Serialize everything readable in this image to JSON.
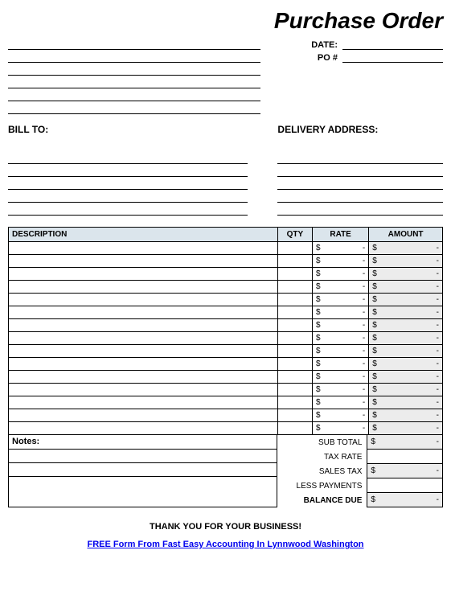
{
  "title": "Purchase Order",
  "meta": {
    "date_label": "DATE:",
    "date_value": "",
    "po_label": "PO #",
    "po_value": ""
  },
  "sections": {
    "bill_to": "BILL TO:",
    "delivery_address": "DELIVERY ADDRESS:"
  },
  "table": {
    "headers": {
      "description": "DESCRIPTION",
      "qty": "QTY",
      "rate": "RATE",
      "amount": "AMOUNT"
    },
    "rows": [
      {
        "desc": "",
        "qty": "",
        "rate_sym": "$",
        "rate_val": "-",
        "amt_sym": "$",
        "amt_val": "-"
      },
      {
        "desc": "",
        "qty": "",
        "rate_sym": "$",
        "rate_val": "-",
        "amt_sym": "$",
        "amt_val": "-"
      },
      {
        "desc": "",
        "qty": "",
        "rate_sym": "$",
        "rate_val": "-",
        "amt_sym": "$",
        "amt_val": "-"
      },
      {
        "desc": "",
        "qty": "",
        "rate_sym": "$",
        "rate_val": "-",
        "amt_sym": "$",
        "amt_val": "-"
      },
      {
        "desc": "",
        "qty": "",
        "rate_sym": "$",
        "rate_val": "-",
        "amt_sym": "$",
        "amt_val": "-"
      },
      {
        "desc": "",
        "qty": "",
        "rate_sym": "$",
        "rate_val": "-",
        "amt_sym": "$",
        "amt_val": "-"
      },
      {
        "desc": "",
        "qty": "",
        "rate_sym": "$",
        "rate_val": "-",
        "amt_sym": "$",
        "amt_val": "-"
      },
      {
        "desc": "",
        "qty": "",
        "rate_sym": "$",
        "rate_val": "-",
        "amt_sym": "$",
        "amt_val": "-"
      },
      {
        "desc": "",
        "qty": "",
        "rate_sym": "$",
        "rate_val": "-",
        "amt_sym": "$",
        "amt_val": "-"
      },
      {
        "desc": "",
        "qty": "",
        "rate_sym": "$",
        "rate_val": "-",
        "amt_sym": "$",
        "amt_val": "-"
      },
      {
        "desc": "",
        "qty": "",
        "rate_sym": "$",
        "rate_val": "-",
        "amt_sym": "$",
        "amt_val": "-"
      },
      {
        "desc": "",
        "qty": "",
        "rate_sym": "$",
        "rate_val": "-",
        "amt_sym": "$",
        "amt_val": "-"
      },
      {
        "desc": "",
        "qty": "",
        "rate_sym": "$",
        "rate_val": "-",
        "amt_sym": "$",
        "amt_val": "-"
      },
      {
        "desc": "",
        "qty": "",
        "rate_sym": "$",
        "rate_val": "-",
        "amt_sym": "$",
        "amt_val": "-"
      },
      {
        "desc": "",
        "qty": "",
        "rate_sym": "$",
        "rate_val": "-",
        "amt_sym": "$",
        "amt_val": "-"
      }
    ]
  },
  "notes_label": "Notes:",
  "totals": {
    "subtotal_label": "SUB TOTAL",
    "subtotal_sym": "$",
    "subtotal_val": "-",
    "taxrate_label": "TAX RATE",
    "taxrate_val": "",
    "salestax_label": "SALES TAX",
    "salestax_sym": "$",
    "salestax_val": "-",
    "lesspayments_label": "LESS PAYMENTS",
    "lesspayments_val": "",
    "balancedue_label": "BALANCE DUE",
    "balancedue_sym": "$",
    "balancedue_val": "-"
  },
  "thank_you": "THANK YOU FOR YOUR BUSINESS!",
  "footer_link": "FREE Form From Fast Easy Accounting In Lynnwood Washington"
}
